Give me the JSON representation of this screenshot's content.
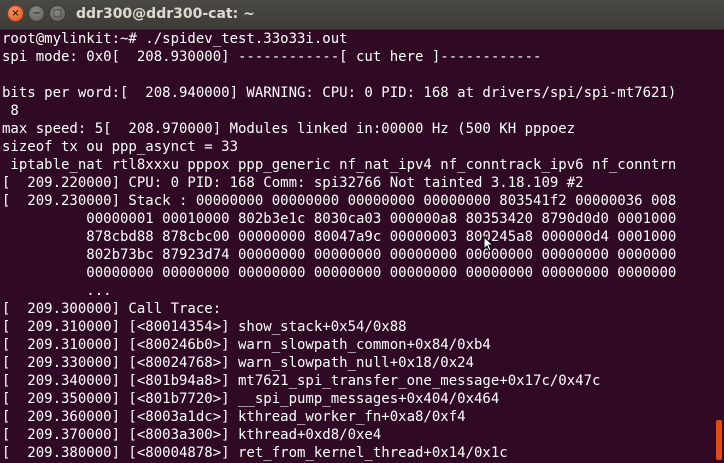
{
  "window": {
    "title": "ddr300@ddr300-cat: ~",
    "close_glyph": "×",
    "minimize_glyph": "−",
    "maximize_glyph": "□"
  },
  "terminal": {
    "lines": [
      "root@mylinkit:~# ./spidev_test.33o33i.out",
      "spi mode: 0x0[  208.930000] ------------[ cut here ]------------",
      "",
      "bits per word:[  208.940000] WARNING: CPU: 0 PID: 168 at drivers/spi/spi-mt7621)",
      " 8",
      "max speed: 5[  208.970000] Modules linked in:00000 Hz (500 KH pppoez",
      "sizeof tx ou ppp_asynct = 33",
      " iptable_nat rtl8xxxu pppox ppp_generic nf_nat_ipv4 nf_conntrack_ipv6 nf_conntrn",
      "[  209.220000] CPU: 0 PID: 168 Comm: spi32766 Not tainted 3.18.109 #2",
      "[  209.230000] Stack : 00000000 00000000 00000000 00000000 803541f2 00000036 008",
      "          00000001 00010000 802b3e1c 8030ca03 000000a8 80353420 8790d0d0 0001000",
      "          878cbd88 878cbc00 00000000 80047a9c 00000003 800245a8 000000d4 0001000",
      "          802b73bc 87923d74 00000000 00000000 00000000 00000000 00000000 0000000",
      "          00000000 00000000 00000000 00000000 00000000 00000000 00000000 0000000",
      "          ...",
      "[  209.300000] Call Trace:",
      "[  209.310000] [<80014354>] show_stack+0x54/0x88",
      "[  209.310000] [<800246b0>] warn_slowpath_common+0x84/0xb4",
      "[  209.330000] [<80024768>] warn_slowpath_null+0x18/0x24",
      "[  209.340000] [<801b94a8>] mt7621_spi_transfer_one_message+0x17c/0x47c",
      "[  209.350000] [<801b7720>] __spi_pump_messages+0x404/0x464",
      "[  209.360000] [<8003a1dc>] kthread_worker_fn+0xa8/0xf4",
      "[  209.370000] [<8003a300>] kthread+0xd8/0xe4",
      "[  209.380000] [<80004878>] ret_from_kernel_thread+0x14/0x1c"
    ]
  },
  "colors": {
    "terminal_background": "#300a24",
    "terminal_text": "#ffffff",
    "titlebar": "#3c3b37",
    "close_button": "#df4b14"
  }
}
